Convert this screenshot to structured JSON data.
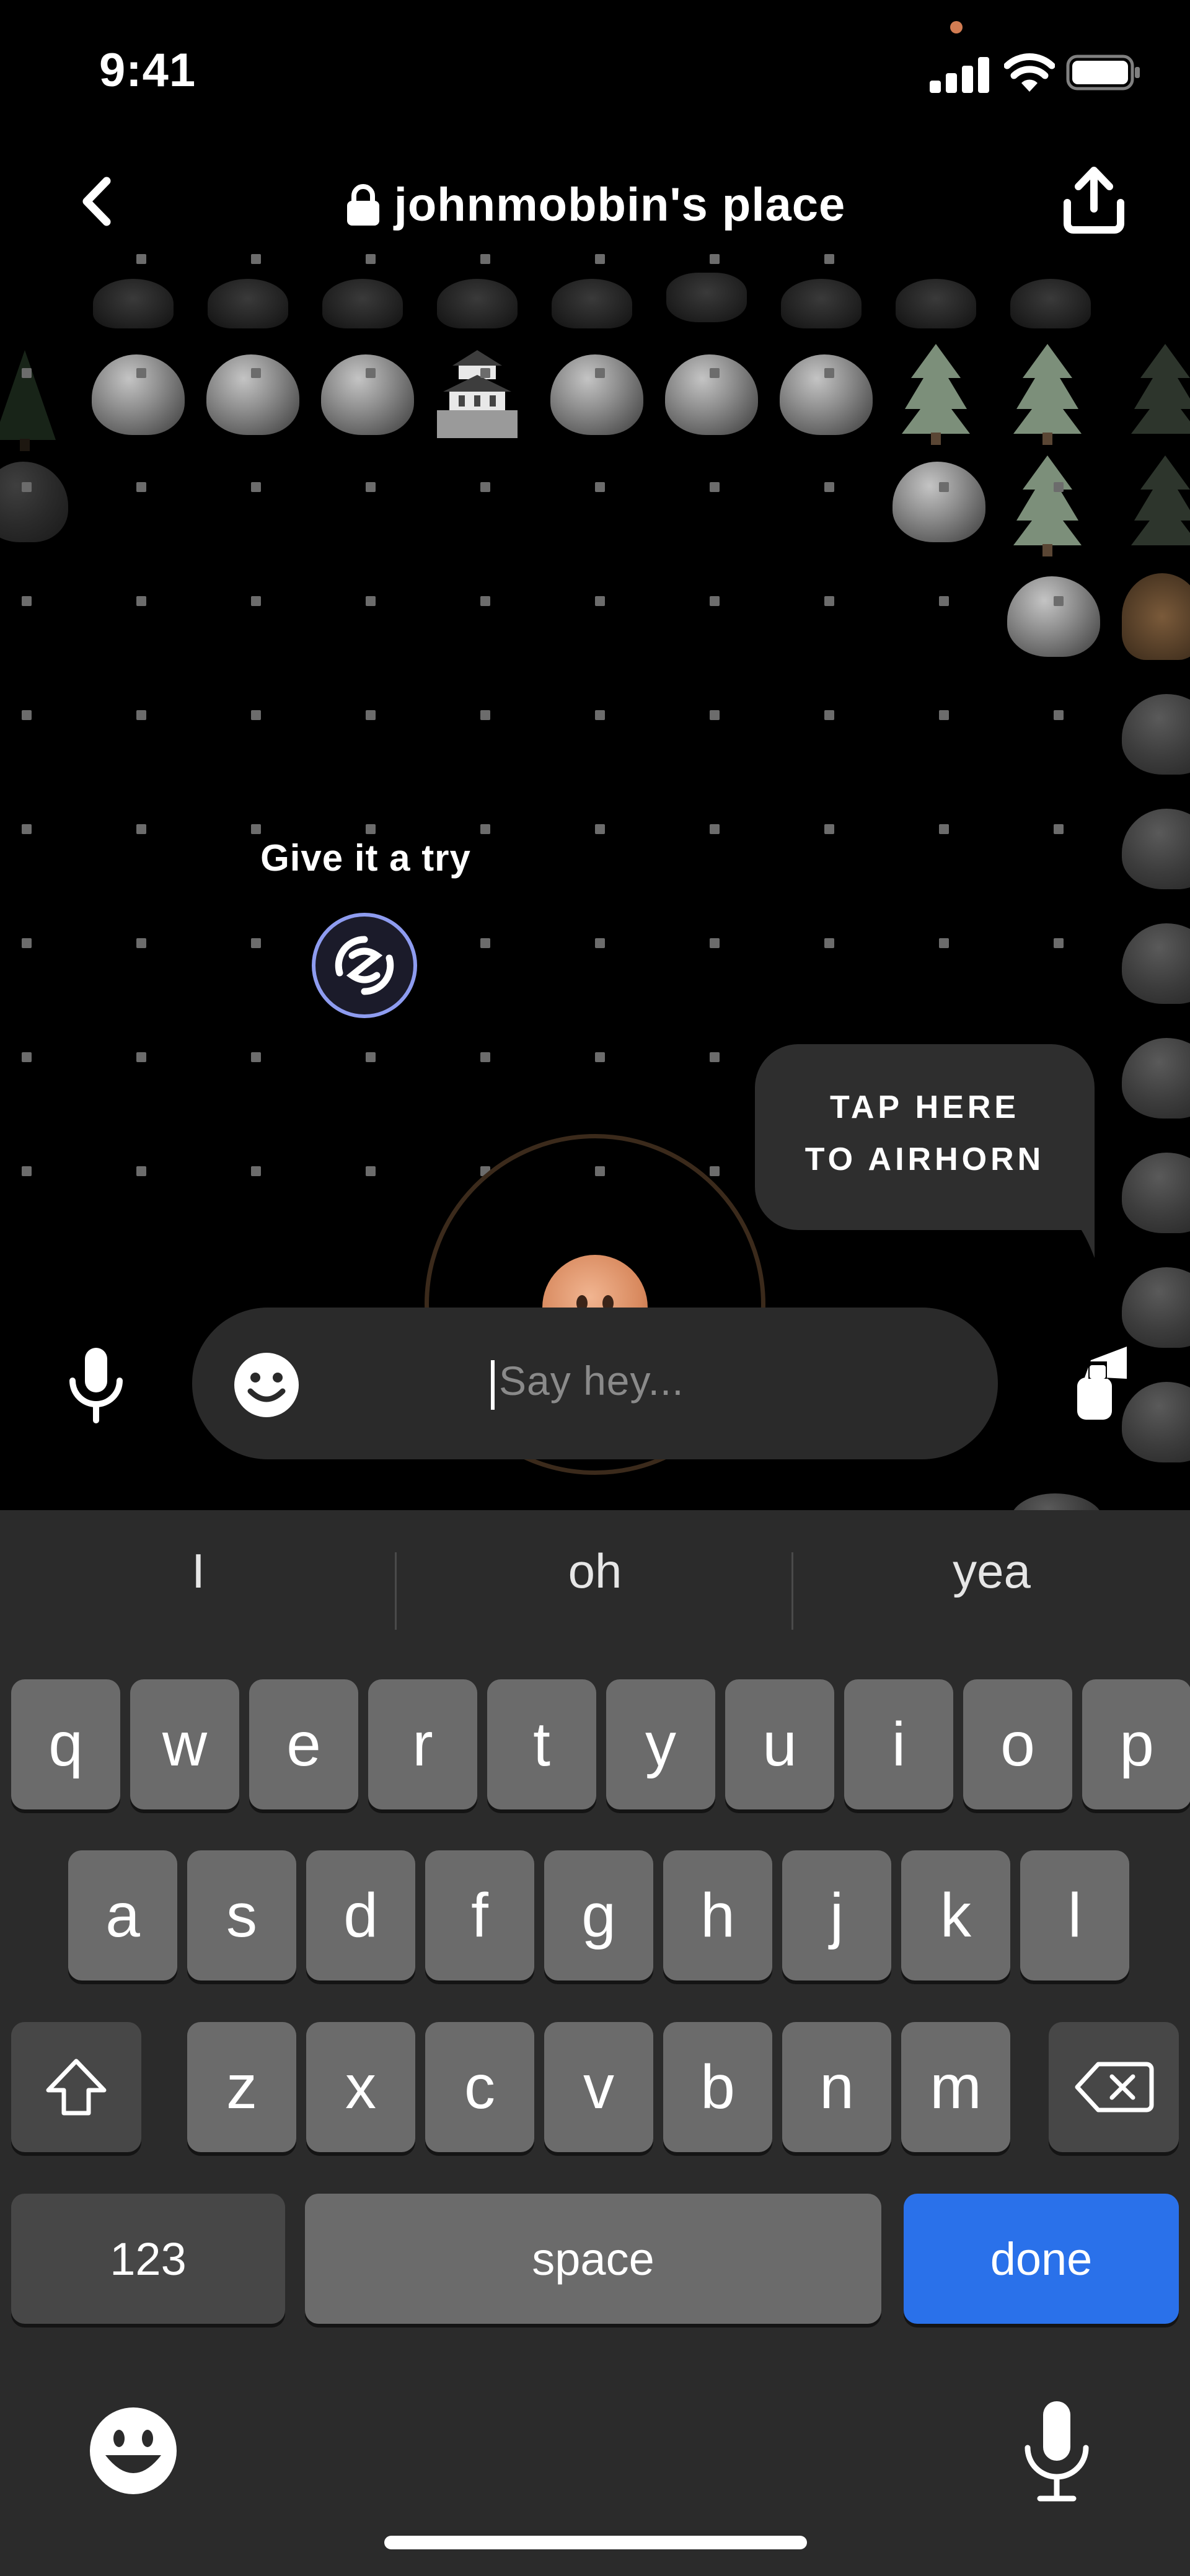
{
  "status_bar": {
    "time": "9:41"
  },
  "header": {
    "title": "johnmobbin's place"
  },
  "world": {
    "hint_label": "Give it a try",
    "airhorn_bubble": [
      "TAP HERE",
      "TO AIRHORN"
    ]
  },
  "chat": {
    "placeholder": "Say hey..."
  },
  "keyboard": {
    "suggestions": [
      "I",
      "oh",
      "yea"
    ],
    "row1": [
      "q",
      "w",
      "e",
      "r",
      "t",
      "y",
      "u",
      "i",
      "o",
      "p"
    ],
    "row2": [
      "a",
      "s",
      "d",
      "f",
      "g",
      "h",
      "j",
      "k",
      "l"
    ],
    "row3": [
      "z",
      "x",
      "c",
      "v",
      "b",
      "n",
      "m"
    ],
    "numbers_label": "123",
    "space_label": "space",
    "done_label": "done"
  },
  "colors": {
    "accent_blue": "#2a71ea",
    "try_ring": "#8e9cf0",
    "avatar_ring": "#3b2a1b"
  }
}
